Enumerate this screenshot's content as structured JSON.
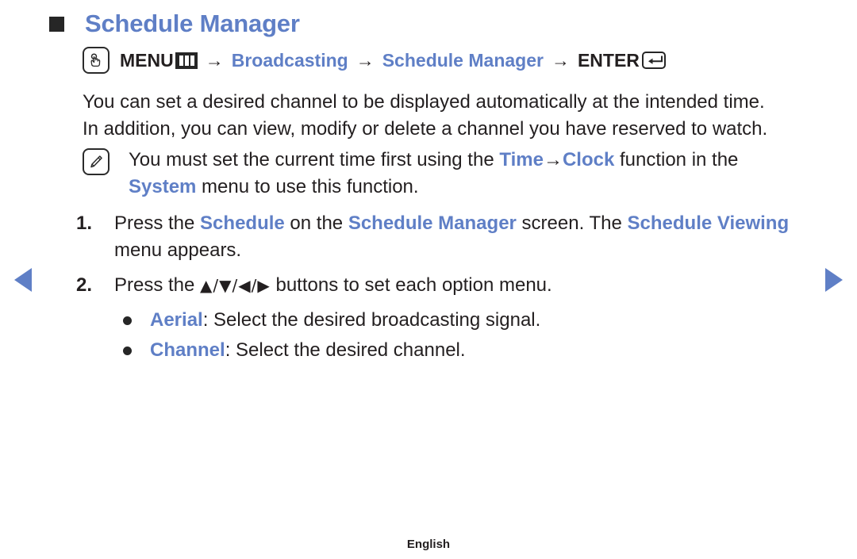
{
  "page": {
    "title": "Schedule Manager",
    "footer_label": "English"
  },
  "nav": {
    "prev_label": "previous page",
    "next_label": "next page"
  },
  "breadcrumb": {
    "touch_icon": "touch-press-icon",
    "menu_label": "MENU",
    "menu_icon": "menu-grid-icon",
    "separator": "→",
    "item_broadcasting": "Broadcasting",
    "item_schedule_manager": "Schedule Manager",
    "enter_label": "ENTER",
    "enter_icon": "enter-return-icon"
  },
  "intro": {
    "line1": "You can set a desired channel to be displayed automatically at the intended time.",
    "line2": "In addition, you can view, modify or delete a channel you have reserved to watch."
  },
  "note": {
    "icon": "note-pencil-icon",
    "text_part1": "You must set the current time first using the ",
    "highlight_time": "Time",
    "arrow": "→",
    "highlight_clock": "Clock",
    "text_part2": " function in the ",
    "highlight_system": "System",
    "text_part3": " menu to use this function."
  },
  "steps": [
    {
      "number": "1.",
      "part1": "Press the ",
      "highlight1": "Schedule",
      "part2": " on the ",
      "highlight2": "Schedule Manager",
      "part3": " screen. The ",
      "highlight3": "Schedule Viewing",
      "part4": " menu appears."
    },
    {
      "number": "2.",
      "part1": "Press the ",
      "glyphs": "▲/▼/◀/▶",
      "part2": " buttons to set each option menu."
    }
  ],
  "bullets": [
    {
      "label": "Aerial",
      "text": ": Select the desired broadcasting signal."
    },
    {
      "label": "Channel",
      "text": ": Select the desired channel."
    }
  ],
  "colors": {
    "accent_blue": "#5f7fc6",
    "body_text": "#231f20",
    "background": "#ffffff"
  }
}
